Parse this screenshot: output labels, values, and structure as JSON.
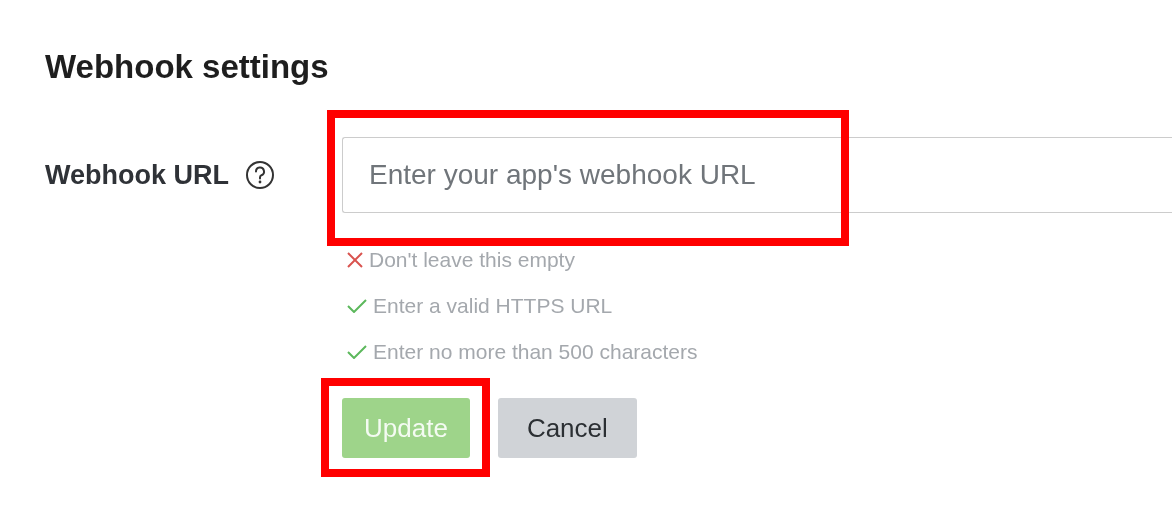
{
  "title": "Webhook settings",
  "field": {
    "label": "Webhook URL",
    "help_icon": true,
    "placeholder": "Enter your app's webhook URL",
    "highlighted": true
  },
  "rules": [
    {
      "text": "Don't leave this empty",
      "passed": false
    },
    {
      "text": "Enter a valid HTTPS URL",
      "passed": true
    },
    {
      "text": "Enter no more than 500 characters",
      "passed": true
    }
  ],
  "buttons": [
    {
      "label": "Update",
      "kind": "primary",
      "disabled": true,
      "highlighted": true
    },
    {
      "label": "Cancel",
      "kind": "secondary",
      "disabled": false,
      "highlighted": false
    }
  ]
}
